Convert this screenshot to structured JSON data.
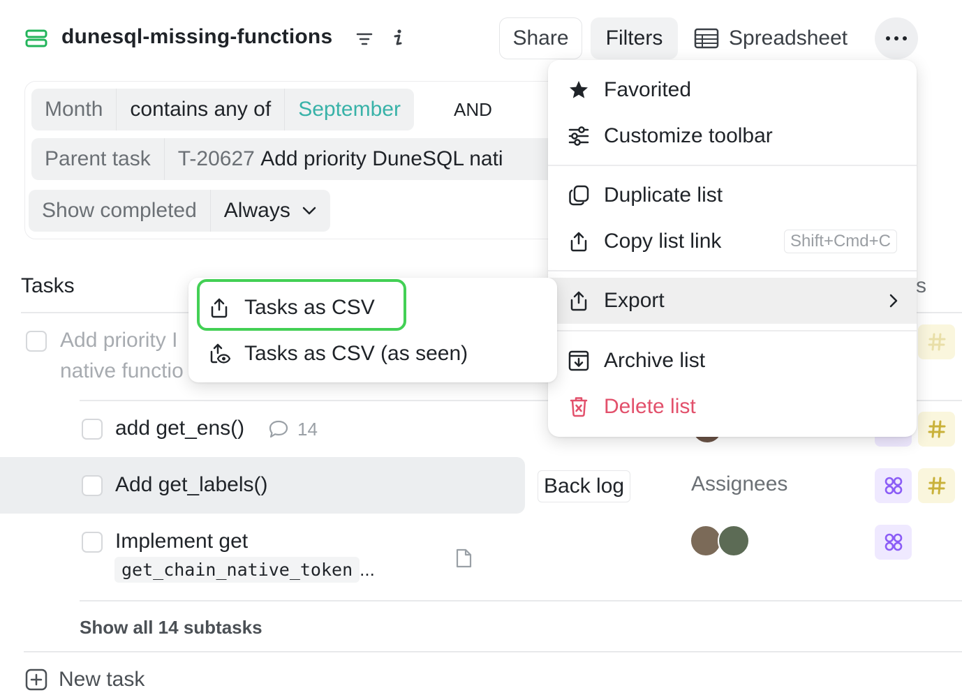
{
  "header": {
    "title": "dunesql-missing-functions",
    "share_label": "Share",
    "filters_label": "Filters",
    "spreadsheet_label": "Spreadsheet"
  },
  "filters": {
    "row1": {
      "field": "Month",
      "operator": "contains any of",
      "value": "September",
      "joiner": "AND"
    },
    "row2": {
      "field": "Parent task",
      "task_id": "T-20627",
      "task_title": "Add priority DuneSQL nati"
    },
    "row3": {
      "field": "Show completed",
      "value": "Always"
    }
  },
  "tasks": {
    "heading": "Tasks",
    "parent": {
      "line1": "Add priority I",
      "line2": "native functio"
    },
    "rows": [
      {
        "title": "add get_ens()",
        "comments": "14"
      },
      {
        "title": "Add get_labels()",
        "status": "Back log",
        "assignees_placeholder": "Assignees"
      },
      {
        "title": "Implement get",
        "code": "get_chain_native_token",
        "ellipsis": "..."
      }
    ],
    "show_all": "Show all 14 subtasks",
    "new_task": "New task",
    "partial_header": "s"
  },
  "menu": {
    "items": [
      {
        "label": "Favorited",
        "icon": "star-icon"
      },
      {
        "label": "Customize toolbar",
        "icon": "sliders-icon"
      },
      {
        "label": "Duplicate list",
        "icon": "duplicate-icon"
      },
      {
        "label": "Copy list link",
        "icon": "share-out-icon",
        "shortcut": "Shift+Cmd+C"
      },
      {
        "label": "Export",
        "icon": "export-icon"
      },
      {
        "label": "Archive list",
        "icon": "archive-icon"
      },
      {
        "label": "Delete list",
        "icon": "trash-icon"
      }
    ]
  },
  "submenu": {
    "items": [
      {
        "label": "Tasks as CSV",
        "icon": "export-icon"
      },
      {
        "label": "Tasks as CSV (as seen)",
        "icon": "export-eye-icon"
      }
    ]
  },
  "colors": {
    "accent_teal": "#38b2a8",
    "highlight_green": "#43d055",
    "danger": "#e2506b",
    "list_icon_green": "#22b45a",
    "tag_purple": "#8b5cf6",
    "tag_yellow": "#c9b13a"
  }
}
